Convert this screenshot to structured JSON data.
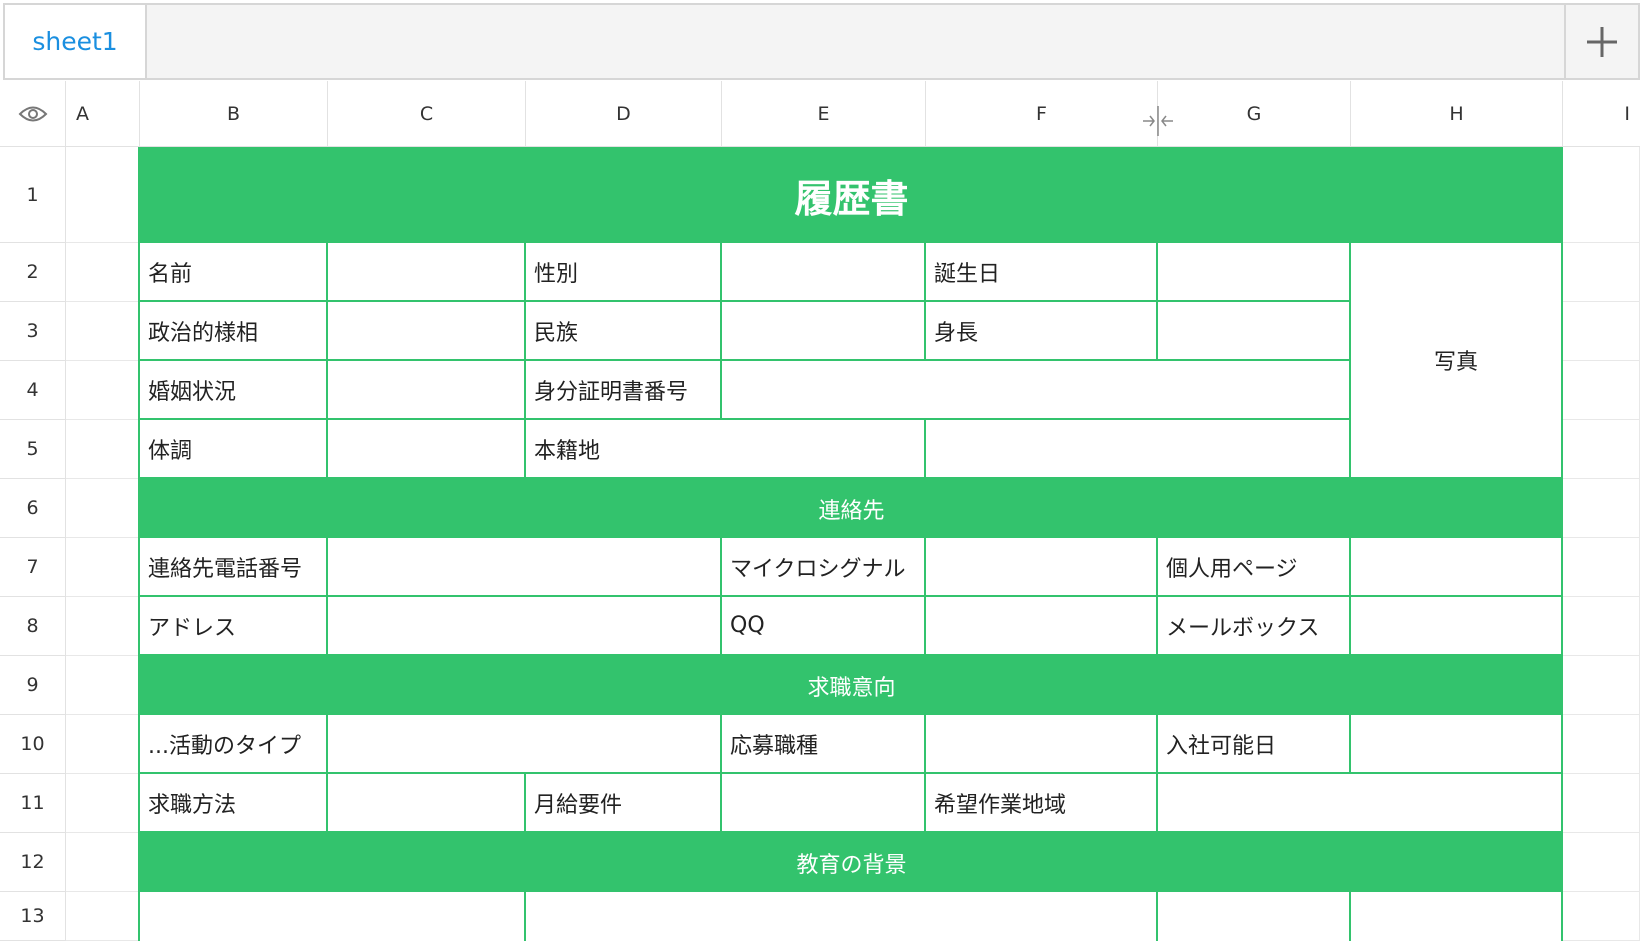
{
  "tabs": {
    "active": "sheet1",
    "add_icon": "plus-icon"
  },
  "colors": {
    "accent": "#33c36d",
    "tab_text": "#1a8fe0",
    "header_text": "#ffffff"
  },
  "header": {
    "visibility_icon": "eye-icon",
    "columns": [
      "A",
      "B",
      "C",
      "D",
      "E",
      "F",
      "G",
      "H",
      "I"
    ],
    "resize_icon": "column-resize-icon"
  },
  "rows": [
    "1",
    "2",
    "3",
    "4",
    "5",
    "6",
    "7",
    "8",
    "9",
    "10",
    "11",
    "12",
    "13"
  ],
  "sheet": {
    "title": "履歴書",
    "r2": {
      "name": "名前",
      "gender": "性別",
      "birthday": "誕生日"
    },
    "photo": "写真",
    "r3": {
      "political": "政治的様相",
      "ethnicity": "民族",
      "height": "身長"
    },
    "r4": {
      "marital": "婚姻状況",
      "id_number": "身分証明書番号"
    },
    "r5": {
      "health": "体調",
      "domicile": "本籍地"
    },
    "section_contact": "連絡先",
    "r7": {
      "phone": "連絡先電話番号",
      "microsignal": "マイクロシグナル",
      "homepage": "個人用ページ"
    },
    "r8": {
      "address": "アドレス",
      "qq": "QQ",
      "mailbox": "メールボックス"
    },
    "section_job": "求職意向",
    "r10": {
      "activity_type": "...活動のタイプ",
      "job_type": "応募職種",
      "start_date": "入社可能日"
    },
    "r11": {
      "method": "求職方法",
      "salary": "月給要件",
      "work_area": "希望作業地域"
    },
    "section_education": "教育の背景"
  }
}
